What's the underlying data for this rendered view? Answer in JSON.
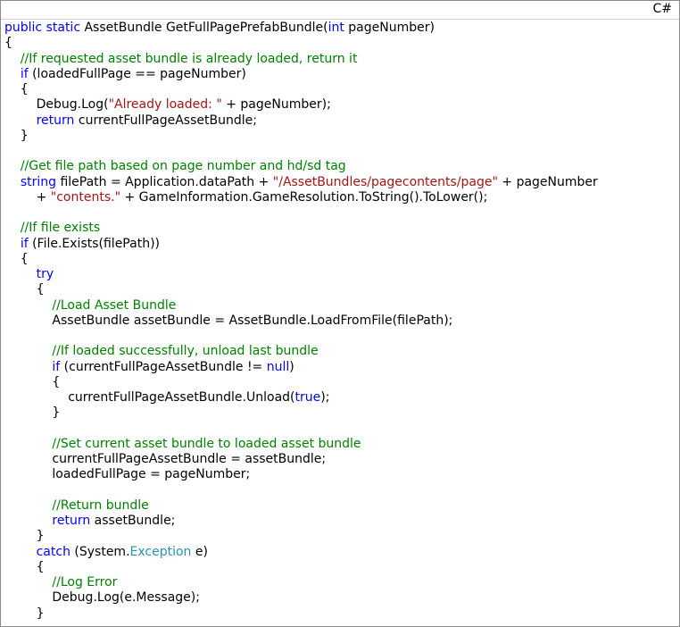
{
  "language_label": "C#",
  "colors": {
    "keyword": "#0000ff",
    "comment": "#008000",
    "string": "#a31515",
    "type": "#2b91af",
    "plain": "#000000"
  },
  "code_lines": [
    [
      [
        "kw",
        "public"
      ],
      [
        "id",
        " "
      ],
      [
        "kw",
        "static"
      ],
      [
        "id",
        " AssetBundle GetFullPagePrefabBundle("
      ],
      [
        "kw",
        "int"
      ],
      [
        "id",
        " pageNumber)"
      ]
    ],
    [
      [
        "id",
        "{"
      ]
    ],
    [
      [
        "id",
        "    "
      ],
      [
        "cm",
        "//If requested asset bundle is already loaded, return it"
      ]
    ],
    [
      [
        "id",
        "    "
      ],
      [
        "kw",
        "if"
      ],
      [
        "id",
        " (loadedFullPage == pageNumber)"
      ]
    ],
    [
      [
        "id",
        "    {"
      ]
    ],
    [
      [
        "id",
        "        Debug.Log("
      ],
      [
        "str",
        "\"Already loaded: \""
      ],
      [
        "id",
        " + pageNumber);"
      ]
    ],
    [
      [
        "id",
        "        "
      ],
      [
        "kw",
        "return"
      ],
      [
        "id",
        " currentFullPageAssetBundle;"
      ]
    ],
    [
      [
        "id",
        "    }"
      ]
    ],
    [
      [
        "id",
        ""
      ]
    ],
    [
      [
        "id",
        "    "
      ],
      [
        "cm",
        "//Get file path based on page number and hd/sd tag"
      ]
    ],
    [
      [
        "id",
        "    "
      ],
      [
        "kw",
        "string"
      ],
      [
        "id",
        " filePath = Application.dataPath + "
      ],
      [
        "str",
        "\"/AssetBundles/pagecontents/page\""
      ],
      [
        "id",
        " + pageNumber"
      ]
    ],
    [
      [
        "id",
        "        + "
      ],
      [
        "str",
        "\"contents.\""
      ],
      [
        "id",
        " + GameInformation.GameResolution.ToString().ToLower();"
      ]
    ],
    [
      [
        "id",
        ""
      ]
    ],
    [
      [
        "id",
        "    "
      ],
      [
        "cm",
        "//If file exists"
      ]
    ],
    [
      [
        "id",
        "    "
      ],
      [
        "kw",
        "if"
      ],
      [
        "id",
        " (File.Exists(filePath))"
      ]
    ],
    [
      [
        "id",
        "    {"
      ]
    ],
    [
      [
        "id",
        "        "
      ],
      [
        "kw",
        "try"
      ]
    ],
    [
      [
        "id",
        "        {"
      ]
    ],
    [
      [
        "id",
        "            "
      ],
      [
        "cm",
        "//Load Asset Bundle"
      ]
    ],
    [
      [
        "id",
        "            AssetBundle assetBundle = AssetBundle.LoadFromFile(filePath);"
      ]
    ],
    [
      [
        "id",
        ""
      ]
    ],
    [
      [
        "id",
        "            "
      ],
      [
        "cm",
        "//If loaded successfully, unload last bundle"
      ]
    ],
    [
      [
        "id",
        "            "
      ],
      [
        "kw",
        "if"
      ],
      [
        "id",
        " (currentFullPageAssetBundle != "
      ],
      [
        "kw",
        "null"
      ],
      [
        "id",
        ")"
      ]
    ],
    [
      [
        "id",
        "            {"
      ]
    ],
    [
      [
        "id",
        "                currentFullPageAssetBundle.Unload("
      ],
      [
        "kw",
        "true"
      ],
      [
        "id",
        ");"
      ]
    ],
    [
      [
        "id",
        "            }"
      ]
    ],
    [
      [
        "id",
        ""
      ]
    ],
    [
      [
        "id",
        "            "
      ],
      [
        "cm",
        "//Set current asset bundle to loaded asset bundle"
      ]
    ],
    [
      [
        "id",
        "            currentFullPageAssetBundle = assetBundle;"
      ]
    ],
    [
      [
        "id",
        "            loadedFullPage = pageNumber;"
      ]
    ],
    [
      [
        "id",
        ""
      ]
    ],
    [
      [
        "id",
        "            "
      ],
      [
        "cm",
        "//Return bundle"
      ]
    ],
    [
      [
        "id",
        "            "
      ],
      [
        "kw",
        "return"
      ],
      [
        "id",
        " assetBundle;"
      ]
    ],
    [
      [
        "id",
        "        }"
      ]
    ],
    [
      [
        "id",
        "        "
      ],
      [
        "kw",
        "catch"
      ],
      [
        "id",
        " (System."
      ],
      [
        "ty",
        "Exception"
      ],
      [
        "id",
        " e)"
      ]
    ],
    [
      [
        "id",
        "        {"
      ]
    ],
    [
      [
        "id",
        "            "
      ],
      [
        "cm",
        "//Log Error"
      ]
    ],
    [
      [
        "id",
        "            Debug.Log(e.Message);"
      ]
    ],
    [
      [
        "id",
        "        }"
      ]
    ]
  ]
}
